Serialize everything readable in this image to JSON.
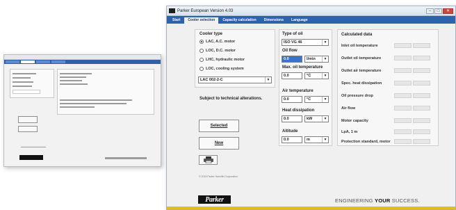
{
  "window": {
    "title": "Parker European Version 4.03"
  },
  "tabs": [
    {
      "label": "Start"
    },
    {
      "label": "Cooler selection"
    },
    {
      "label": "Capacity calculation"
    },
    {
      "label": "Dimensions"
    },
    {
      "label": "Language"
    }
  ],
  "cooler": {
    "heading": "Cooler type",
    "options": [
      {
        "label": "LAC, A.C. motor",
        "selected": true
      },
      {
        "label": "LOC, D.C. motor",
        "selected": false
      },
      {
        "label": "LHC, hydraulic motor",
        "selected": false
      },
      {
        "label": "LOC, cooling system",
        "selected": false
      }
    ],
    "model": "LAC 002-2-C",
    "note": "Subject to technical alterations."
  },
  "buttons": {
    "selected": "Selected",
    "new": "New"
  },
  "params": {
    "oil_type_label": "Type of oil",
    "oil_type": "ISO VG 46",
    "oil_flow_label": "Oil flow",
    "oil_flow": "0.0",
    "oil_flow_unit": "l/min",
    "max_oil_temp_label": "Max. oil temperature",
    "max_oil_temp": "0.0",
    "max_oil_temp_unit": "°C",
    "air_temp_label": "Air temperature",
    "air_temp": "0.0",
    "air_temp_unit": "°C",
    "heat_label": "Heat dissipation",
    "heat": "0.0",
    "heat_unit": "kW",
    "altitude_label": "Altitude",
    "altitude": "0.0",
    "altitude_unit": "m"
  },
  "calculated": {
    "heading": "Calculated data",
    "rows": [
      {
        "label": "Inlet oil temperature"
      },
      {
        "label": "Outlet oil temperature"
      },
      {
        "label": "Outlet air temperature"
      },
      {
        "label": "Spec. heat dissipation"
      },
      {
        "label": "Oil pressure drop"
      },
      {
        "label": "Air flow"
      },
      {
        "label": "Motor capacity"
      },
      {
        "label": "LpA, 1 m"
      },
      {
        "label": "Protection standard, motor"
      }
    ]
  },
  "footer": {
    "copyright": "© 2013 Parker Hannifin Corporation",
    "logo_text": "Parker",
    "slogan_prefix": "ENGINEERING ",
    "slogan_bold": "YOUR",
    "slogan_suffix": " SUCCESS."
  },
  "icons": {
    "print": "printer-icon"
  }
}
